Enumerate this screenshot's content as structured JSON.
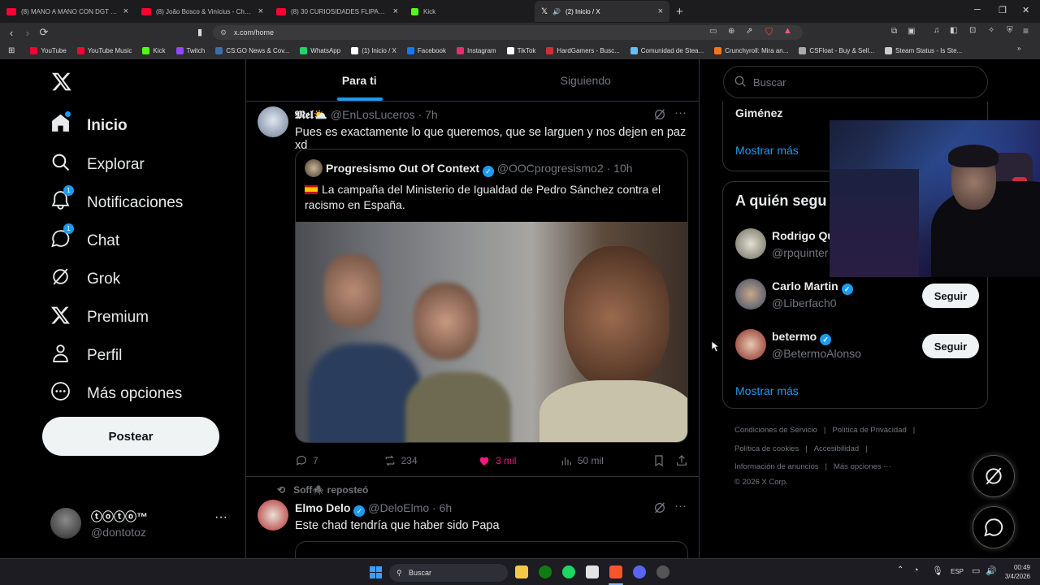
{
  "browser": {
    "tabs": [
      {
        "label": "(8) MANO A MANO CON DGT | \"La g",
        "color": "#ff0033"
      },
      {
        "label": "(8) João Bosco & Vinícius - Chora M",
        "color": "#ff0033"
      },
      {
        "label": "(8) 30 CURIOSIDADES FLIPANTES DE",
        "color": "#ff0033"
      },
      {
        "label": "Kick",
        "color": "#53fc18"
      },
      {
        "label": "(2) Inicio / X",
        "color": "#ffffff"
      }
    ],
    "url": "x.com/home",
    "bookmarks": [
      {
        "label": "YouTube",
        "color": "#ff0033"
      },
      {
        "label": "YouTube Music",
        "color": "#ff0033"
      },
      {
        "label": "Kick",
        "color": "#53fc18"
      },
      {
        "label": "Twitch",
        "color": "#9146ff"
      },
      {
        "label": "CS:GO News & Cov...",
        "color": "#3d6ea8"
      },
      {
        "label": "WhatsApp",
        "color": "#25d366"
      },
      {
        "label": "(1) Inicio / X",
        "color": "#ffffff"
      },
      {
        "label": "Facebook",
        "color": "#1877f2"
      },
      {
        "label": "Instagram",
        "color": "#e1306c"
      },
      {
        "label": "TikTok",
        "color": "#ffffff"
      },
      {
        "label": "HardGamers - Busc...",
        "color": "#d32f2f"
      },
      {
        "label": "Comunidad de Stea...",
        "color": "#66c0f4"
      },
      {
        "label": "Crunchyroll: Mira an...",
        "color": "#f47521"
      },
      {
        "label": "CSFloat - Buy & Sell...",
        "color": "#aaaaaa"
      },
      {
        "label": "Steam Status - Is Ste...",
        "color": "#cccccc"
      }
    ]
  },
  "nav": {
    "items": [
      {
        "label": "Inicio",
        "icon": "home-icon"
      },
      {
        "label": "Explorar",
        "icon": "search-icon"
      },
      {
        "label": "Notificaciones",
        "icon": "bell-icon",
        "badge": "1"
      },
      {
        "label": "Chat",
        "icon": "chat-icon",
        "badge": "1"
      },
      {
        "label": "Grok",
        "icon": "grok-icon"
      },
      {
        "label": "Premium",
        "icon": "x-logo-icon"
      },
      {
        "label": "Perfil",
        "icon": "person-icon"
      },
      {
        "label": "Más opciones",
        "icon": "more-circle-icon"
      }
    ],
    "post_label": "Postear",
    "account": {
      "name": "ⓣⓞⓣⓞ™",
      "handle": "@dontotoz"
    }
  },
  "feed": {
    "tabs": [
      "Para ti",
      "Siguiendo"
    ],
    "tweet1": {
      "name": "𝕸𝖊𝖑⛅",
      "handle": "@EnLosLuceros",
      "time": "· 7h",
      "text": "Pues es exactamente lo que queremos, que se larguen y nos dejen en paz xd",
      "quote": {
        "name": "Progresismo Out Of Context",
        "handle": "@OOCprogresismo2",
        "time": "· 10h",
        "text": "La campaña del Ministerio de Igualdad de Pedro Sánchez contra el racismo en España."
      },
      "stats": {
        "replies": "7",
        "reposts": "234",
        "likes": "3 mil",
        "views": "50 mil"
      }
    },
    "tweet2": {
      "repost_by": "Soff🕷️ reposteó",
      "name": "Elmo Delo",
      "handle": "@DeloElmo",
      "time": "· 6h",
      "text": "Este chad tendría que haber sido Papa"
    }
  },
  "sidebar": {
    "search_placeholder": "Buscar",
    "trend_partial": "Giménez",
    "show_more": "Mostrar más",
    "who_to_follow_title": "A quién segu",
    "follow": [
      {
        "name": "Rodrigo Qu",
        "handle": "@rpquinter"
      },
      {
        "name": "Carlo Martin",
        "handle": "@Liberfach0",
        "button": "Seguir"
      },
      {
        "name": "betermo",
        "handle": "@BetermoAlonso",
        "button": "Seguir"
      }
    ],
    "show_more_2": "Mostrar más",
    "footer": {
      "line1": [
        "Condiciones de Servicio",
        "Política de Privacidad"
      ],
      "line2": [
        "Política de cookies",
        "Accesibilidad"
      ],
      "line3": [
        "Información de anuncios",
        "Más opciones ···"
      ],
      "copyright": "© 2026 X Corp."
    }
  },
  "taskbar": {
    "search": "Buscar",
    "lang": "ESP",
    "time": "00:49",
    "date": "3/4/2026"
  }
}
